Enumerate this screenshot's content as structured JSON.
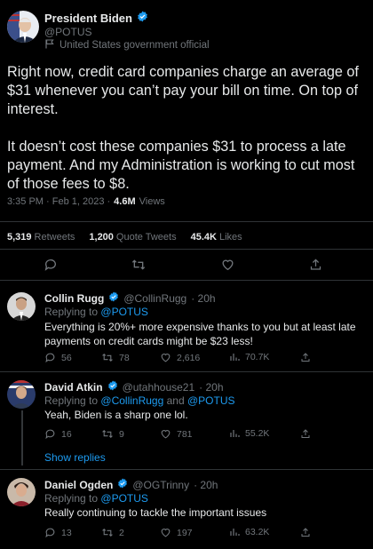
{
  "main": {
    "name": "President Biden",
    "handle": "@POTUS",
    "official_label": "United States government official",
    "text_p1": "Right now, credit card companies charge an average of $31 whenever you can’t pay your bill on time. On top of interest.",
    "text_p2": "It doesn’t cost these companies $31 to process a late payment. And my Administration is working to cut most of those fees to $8.",
    "time": "3:35 PM · Feb 1, 2023 ·",
    "views_count": "4.6M",
    "views_label": "Views",
    "retweets_count": "5,319",
    "retweets_label": "Retweets",
    "quotes_count": "1,200",
    "quotes_label": "Quote Tweets",
    "likes_count": "45.4K",
    "likes_label": "Likes"
  },
  "replies": [
    {
      "name": "Collin Rugg",
      "handle": "@CollinRugg",
      "time": "· 20h",
      "replying_prefix": "Replying to",
      "replying_to": "@POTUS",
      "replying_and": "",
      "replying_to2": "",
      "text": "Everything is 20%+ more expensive thanks to you but at least late payments on credit cards might be $23 less!",
      "replies": "56",
      "retweets": "78",
      "likes": "2,616",
      "views": "70.7K"
    },
    {
      "name": "David Atkin",
      "handle": "@utahhouse21",
      "time": "· 20h",
      "replying_prefix": "Replying to",
      "replying_to": "@CollinRugg",
      "replying_and": "and",
      "replying_to2": "@POTUS",
      "text": "Yeah, Biden is a sharp one lol.",
      "replies": "16",
      "retweets": "9",
      "likes": "781",
      "views": "55.2K"
    },
    {
      "name": "Daniel Ogden",
      "handle": "@OGTrinny",
      "time": "· 20h",
      "replying_prefix": "Replying to",
      "replying_to": "@POTUS",
      "replying_and": "",
      "replying_to2": "",
      "text": "Really continuing to tackle the important issues",
      "replies": "13",
      "retweets": "2",
      "likes": "197",
      "views": "63.2K"
    }
  ],
  "show_replies": "Show replies",
  "colors": {
    "background": "#000000",
    "text": "#e7e9ea",
    "muted": "#71767b",
    "accent": "#1d9bf0",
    "divider": "#2f3336"
  },
  "icons": [
    "verified-badge-icon",
    "flag-icon",
    "reply-icon",
    "retweet-icon",
    "like-icon",
    "views-icon",
    "share-icon"
  ]
}
